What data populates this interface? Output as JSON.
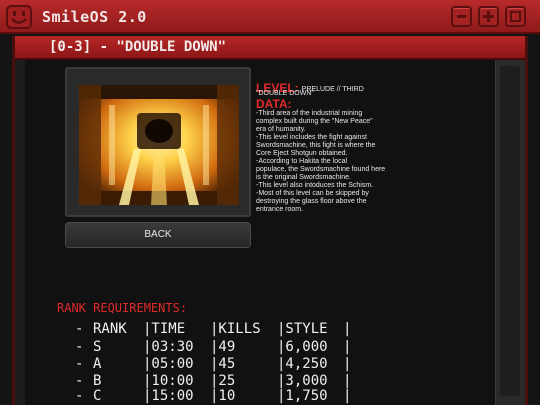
{
  "os": {
    "title": "SmileOS 2.0"
  },
  "window": {
    "title": "[0-3] - \"DOUBLE DOWN\""
  },
  "back_button": "BACK",
  "level": {
    "heading": "LEVEL:",
    "name_line1": "PRELUDE // THIRD",
    "name_line2": "\"DOUBLE DOWN\"",
    "data_heading": "DATA:",
    "data_lines": [
      "-Third area of the industrial mining",
      "complex built during the \"New Peace\"",
      "era of humanity.",
      "-This level includes the fight against",
      "Swordsmachine, this fight is where the",
      "Core Eject Shotgun obtained.",
      "-According to Hakita the local",
      "populace, the Swordsmachine found here",
      "is the original Swordsmachine.",
      "-This level also intoduces the Schism.",
      "-Most of this level can be skipped by",
      "destroying the glass floor above the",
      "entrance room."
    ]
  },
  "rank": {
    "heading": "RANK REQUIREMENTS:",
    "rows": [
      [
        "-",
        "RANK",
        "|TIME",
        "|KILLS",
        "|STYLE",
        "|"
      ],
      [
        "-",
        "S",
        "|03:30",
        "|49",
        "|6,000",
        "|"
      ],
      [
        "-",
        "A",
        "|05:00",
        "|45",
        "|4,250",
        "|"
      ],
      [
        "-",
        "B",
        "|10:00",
        "|25",
        "|3,000",
        "|"
      ],
      [
        "-",
        "C",
        "|15:00",
        "|10",
        "|1,750",
        "|"
      ]
    ]
  },
  "icons": [
    "smile-logo-icon",
    "minimize-icon",
    "maximize-icon",
    "restore-icon"
  ],
  "colors": {
    "accent_red": "#e02a2a",
    "titlebar_red": "#b82a2a"
  }
}
